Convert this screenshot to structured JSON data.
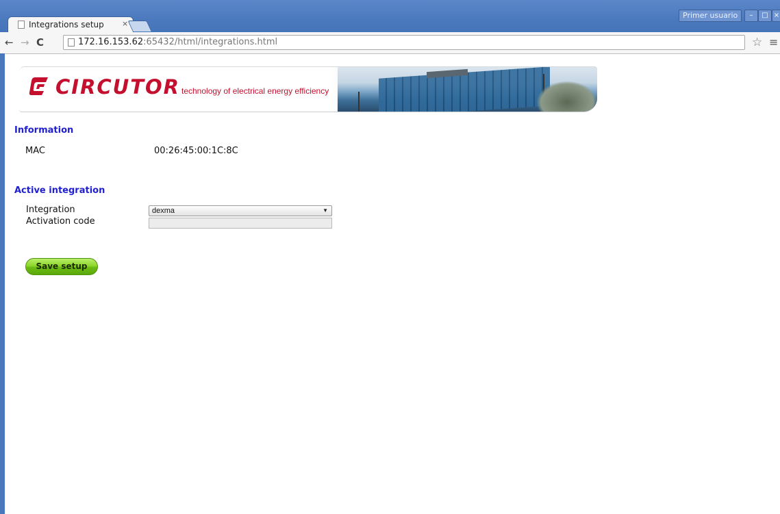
{
  "browser": {
    "tab_title": "Integrations setup",
    "tab_close": "×",
    "profile_label": "Primer usuario",
    "url_host": "172.16.153.62",
    "url_rest": ":65432/html/integrations.html",
    "back_glyph": "←",
    "forward_glyph": "→",
    "reload_glyph": "C",
    "star_glyph": "☆",
    "menu_glyph": "≡",
    "minimize_glyph": "–",
    "maximize_glyph": "□",
    "close_glyph": "×"
  },
  "banner": {
    "logo_text": "CIRCUTOR",
    "tagline": "technology of electrical energy efficiency",
    "brand_color": "#c4102e"
  },
  "information": {
    "title": "Information",
    "mac_label": "MAC",
    "mac_value": "00:26:45:00:1C:8C"
  },
  "active_integration": {
    "title": "Active integration",
    "integration_label": "Integration",
    "integration_selected": "dexma",
    "activation_code_label": "Activation code",
    "activation_code_value": ""
  },
  "actions": {
    "save_label": "Save setup"
  },
  "colors": {
    "section_title": "#1f1fd0",
    "button_green": "#6cbc12"
  }
}
